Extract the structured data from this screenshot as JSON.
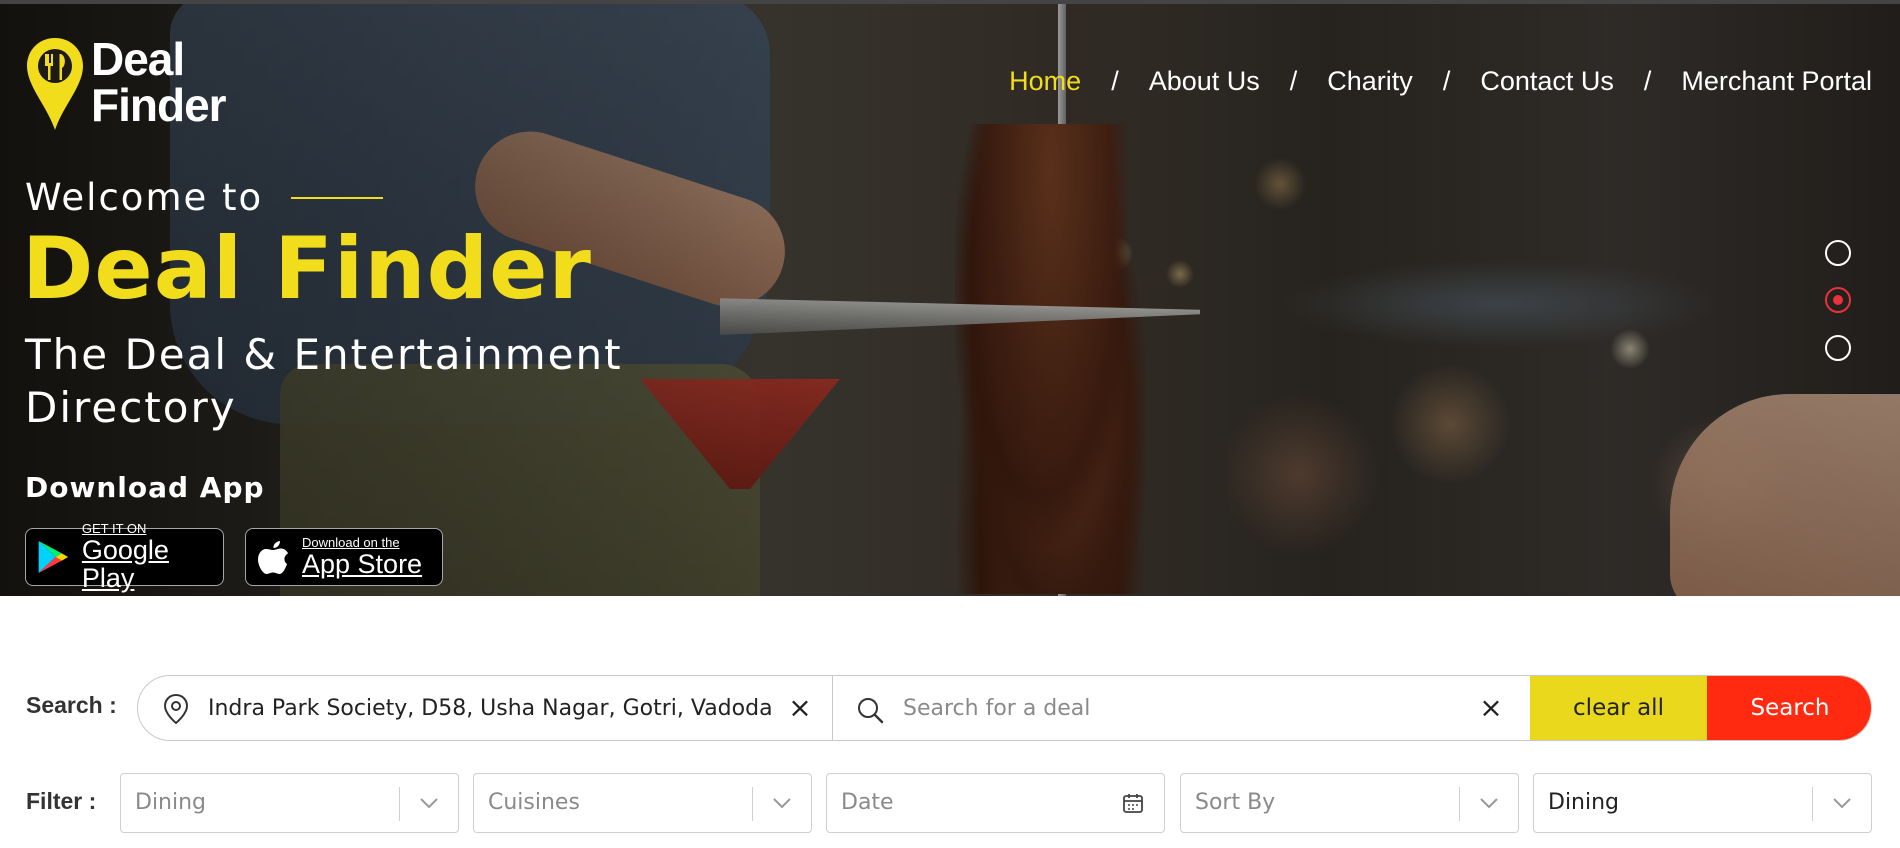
{
  "brand": {
    "logo_line1": "Deal",
    "logo_line2": "Finder",
    "accent": "#f2dd1c"
  },
  "nav": {
    "items": [
      {
        "label": "Home",
        "active": true
      },
      {
        "label": "About Us"
      },
      {
        "label": "Charity"
      },
      {
        "label": "Contact Us"
      },
      {
        "label": "Merchant Portal"
      }
    ],
    "separator": "/"
  },
  "hero": {
    "welcome": "Welcome to",
    "title": "Deal Finder",
    "subtitle": "The Deal & Entertainment Directory",
    "download_label": "Download App",
    "google_play": {
      "small": "GET IT ON",
      "big": "Google Play"
    },
    "app_store": {
      "small": "Download on the",
      "big": "App Store"
    },
    "slider": {
      "count": 3,
      "active_index": 1,
      "active_color": "#e8333a"
    }
  },
  "search": {
    "label": "Search :",
    "location_value": "Indra Park Society, D58, Usha Nagar, Gotri, Vadodara",
    "deal_placeholder": "Search for a deal",
    "clear_label": "×",
    "clear_all_label": "clear all",
    "search_button_label": "Search",
    "clear_all_color": "#ead81d",
    "search_color": "#ff2a10"
  },
  "filter": {
    "label": "Filter :",
    "dining": "Dining",
    "cuisines": "Cuisines",
    "date": "Date",
    "sort_by": "Sort By",
    "category": "Dining"
  }
}
